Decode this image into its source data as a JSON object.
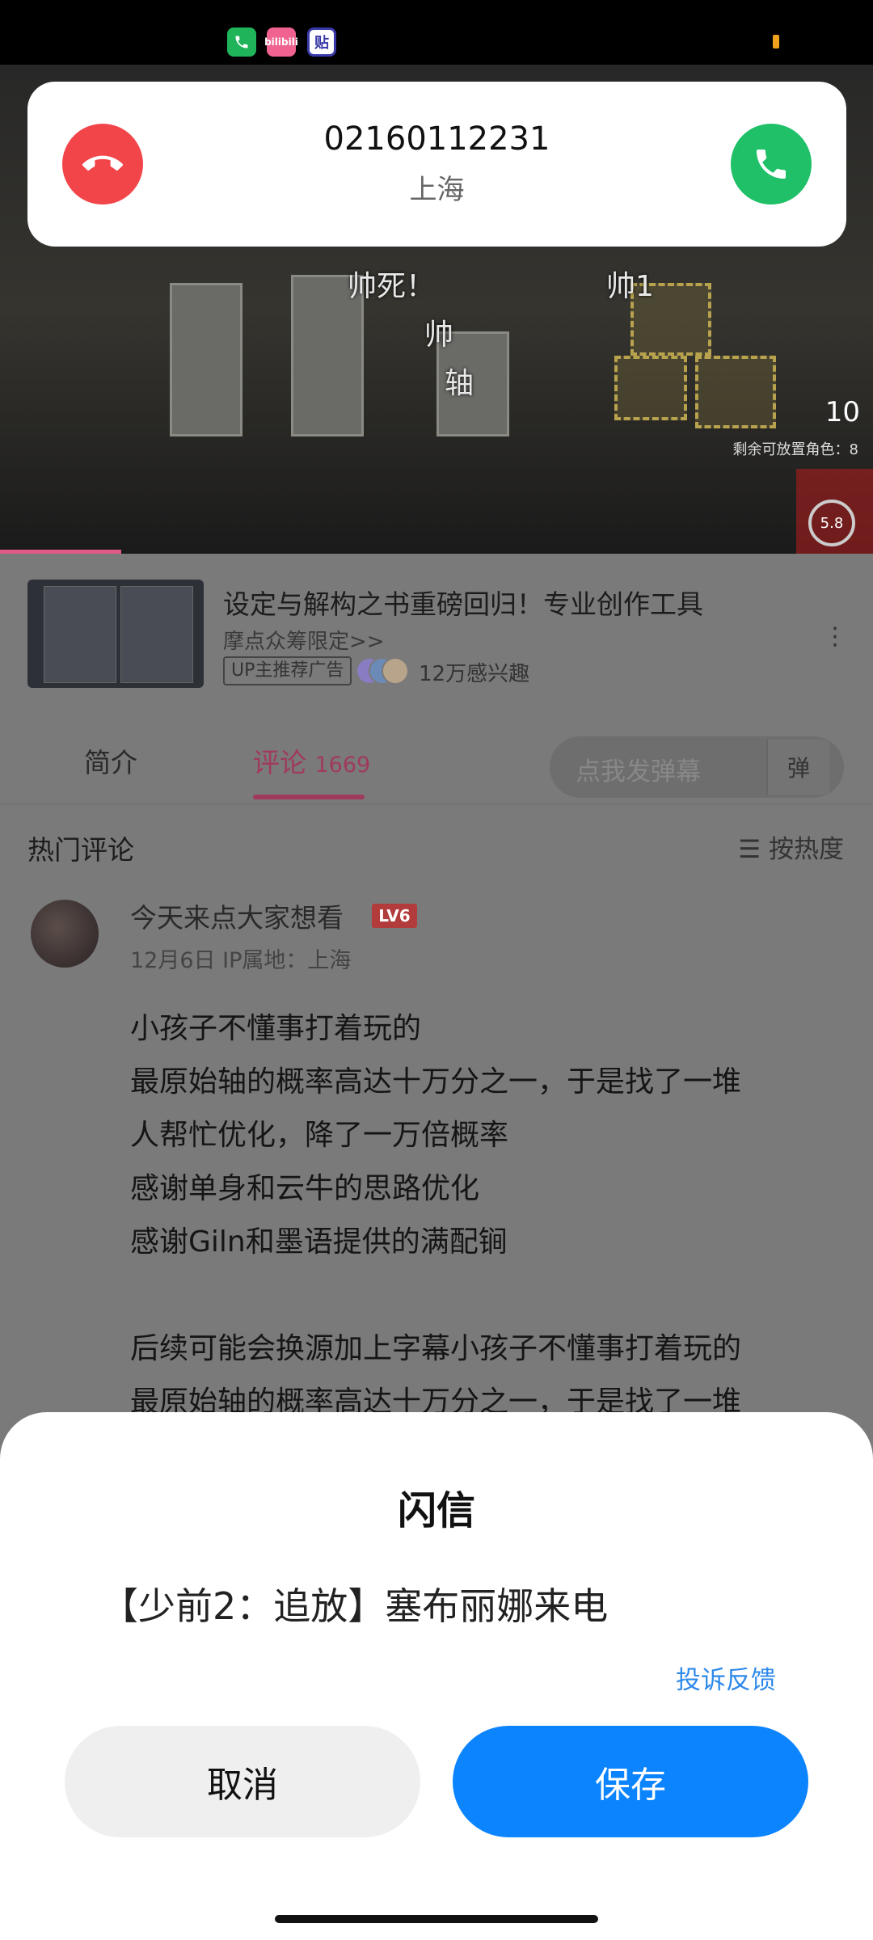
{
  "status_bar": {
    "icons": [
      "phone-app-icon",
      "bilibili-app-icon",
      "tieba-app-icon"
    ],
    "bili_label": "bilibili",
    "tie_label": "贴"
  },
  "video": {
    "danmaku": [
      "帅死！",
      "帅1",
      "帅",
      "轴"
    ],
    "hud_count": "10",
    "hud_sub": "剩余可放置角色：8",
    "hud_timer": "5.8"
  },
  "incoming_call": {
    "number": "02160112231",
    "location": "上海"
  },
  "ad": {
    "title": "设定与解构之书重磅回归！专业创作工具",
    "subtitle": "摩点众筹限定>>",
    "badge": "UP主推荐广告",
    "interest": "12万感兴趣"
  },
  "tabs": {
    "intro": "简介",
    "comments": "评论",
    "comment_count": "1669",
    "danmaku_placeholder": "点我发弹幕",
    "danmaku_button": "弹"
  },
  "comments": {
    "section_title": "热门评论",
    "sort_label": "按热度",
    "top": {
      "username": "今天来点大家想看",
      "level": "LV6",
      "meta": "12月6日  IP属地：上海",
      "lines": [
        "小孩子不懂事打着玩的",
        "最原始轴的概率高达十万分之一，于是找了一堆",
        "人帮忙优化，降了一万倍概率",
        "感谢单身和云牛的思路优化",
        "感谢Giln和墨语提供的满配锏",
        "",
        "后续可能会换源加上字幕小孩子不懂事打着玩的",
        "最原始轴的概率高达十万分之一，于是找了一堆"
      ]
    }
  },
  "dialog": {
    "title": "闪信",
    "message": "【少前2：追放】塞布丽娜来电",
    "report_link": "投诉反馈",
    "cancel": "取消",
    "save": "保存"
  },
  "colors": {
    "accept": "#1fc068",
    "decline": "#f2454a",
    "primary": "#0b84fe",
    "link": "#2d89ea",
    "tab_active": "#a03a5d"
  }
}
